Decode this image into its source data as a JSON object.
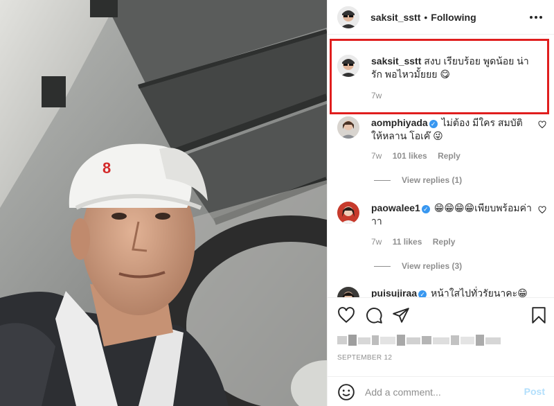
{
  "post": {
    "username": "saksit_sstt",
    "separator": "•",
    "follow_status": "Following"
  },
  "caption": {
    "username": "saksit_sstt",
    "text": "สงบ เรียบร้อย พูดน้อย น่ารัก พอไหวมั้ยยย 😋",
    "time": "7w"
  },
  "comments": [
    {
      "username": "aomphiyada",
      "text": "ไม่ต้อง มีใคร สมบัติให้หลาน โอเค๊ 😜",
      "time": "7w",
      "likes": "101 likes",
      "reply": "Reply",
      "view_replies": "View replies (1)"
    },
    {
      "username": "paowalee1",
      "text": "😁😁😁😁เพียบพร้อมค่าาา",
      "time": "7w",
      "likes": "11 likes",
      "reply": "Reply",
      "view_replies": "View replies (3)"
    },
    {
      "username": "puisujiraa",
      "text": "หน้าใสไปทั่วรัยนาคะ😁"
    }
  ],
  "date": "SEPTEMBER 12",
  "add_comment": {
    "placeholder": "Add a comment...",
    "post_label": "Post"
  },
  "colors": {
    "highlight_box": "#e01e1e",
    "verified": "#3897f0",
    "muted_text": "#8e8e8e",
    "post_button": "#b2dffc"
  },
  "icons": [
    "more-options-icon",
    "verified-badge-icon",
    "heart-icon",
    "comment-icon",
    "share-icon",
    "bookmark-icon",
    "emoji-icon"
  ]
}
